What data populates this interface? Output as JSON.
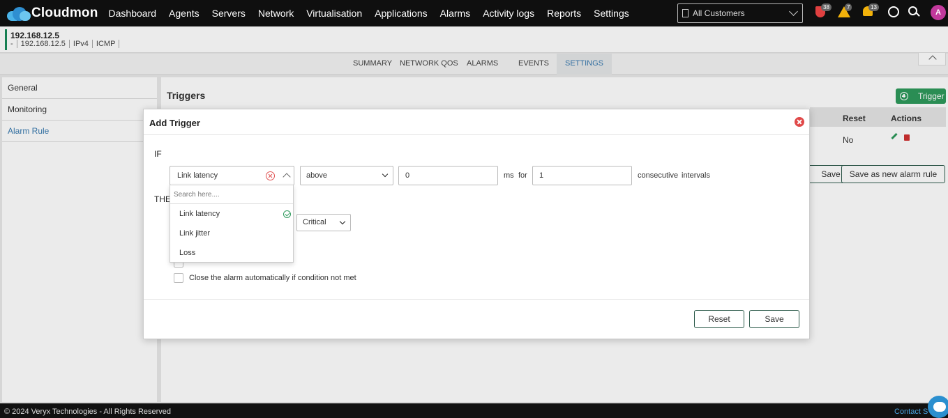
{
  "app": {
    "brand": "Cloudmon"
  },
  "nav": {
    "items": [
      "Dashboard",
      "Agents",
      "Servers",
      "Network",
      "Virtualisation",
      "Applications",
      "Alarms",
      "Activity logs",
      "Reports",
      "Settings"
    ]
  },
  "topbar": {
    "customer_select": "All Customers",
    "badges": {
      "shield": "38",
      "warning": "7",
      "bell": "13"
    },
    "avatar": "A"
  },
  "device": {
    "ip": "192.168.12.5",
    "meta": [
      "-",
      "192.168.12.5",
      "IPv4",
      "ICMP"
    ]
  },
  "tabs": [
    {
      "label": "SUMMARY"
    },
    {
      "label": "NETWORK QOS"
    },
    {
      "label": "ALARMS"
    },
    {
      "label": "EVENTS"
    },
    {
      "label": "SETTINGS",
      "active": true
    }
  ],
  "left_menu": [
    {
      "label": "General"
    },
    {
      "label": "Monitoring"
    },
    {
      "label": "Alarm Rule",
      "active": true
    }
  ],
  "main": {
    "title": "Triggers",
    "trigger_button": "Trigger",
    "table": {
      "headers": {
        "reset": "Reset",
        "actions": "Actions"
      },
      "row": {
        "reset": "No"
      }
    },
    "save_button": "Save",
    "save_new_button": "Save as new alarm rule"
  },
  "modal": {
    "title": "Add Trigger",
    "if_label": "IF",
    "then_label": "THE",
    "metric": "Link latency",
    "operator": "above",
    "threshold": "0",
    "unit": "ms",
    "for_label": "for",
    "intervals": "1",
    "consecutive_label": "consecutive",
    "intervals_label": "intervals",
    "severity": "Critical",
    "checkbox_close_label": "Close the alarm automatically if condition not met",
    "reset_button": "Reset",
    "save_button": "Save"
  },
  "dropdown": {
    "search_placeholder": "Search here....",
    "options": [
      "Link latency",
      "Link jitter",
      "Loss"
    ],
    "selected": "Link latency"
  },
  "footer": {
    "copyright": "© 2024 Veryx Technologies - All Rights Reserved",
    "contact": "Contact S"
  },
  "colors": {
    "accent_green": "#2e9a5c",
    "link_blue": "#3a7bb0",
    "close_red": "#e04848"
  }
}
